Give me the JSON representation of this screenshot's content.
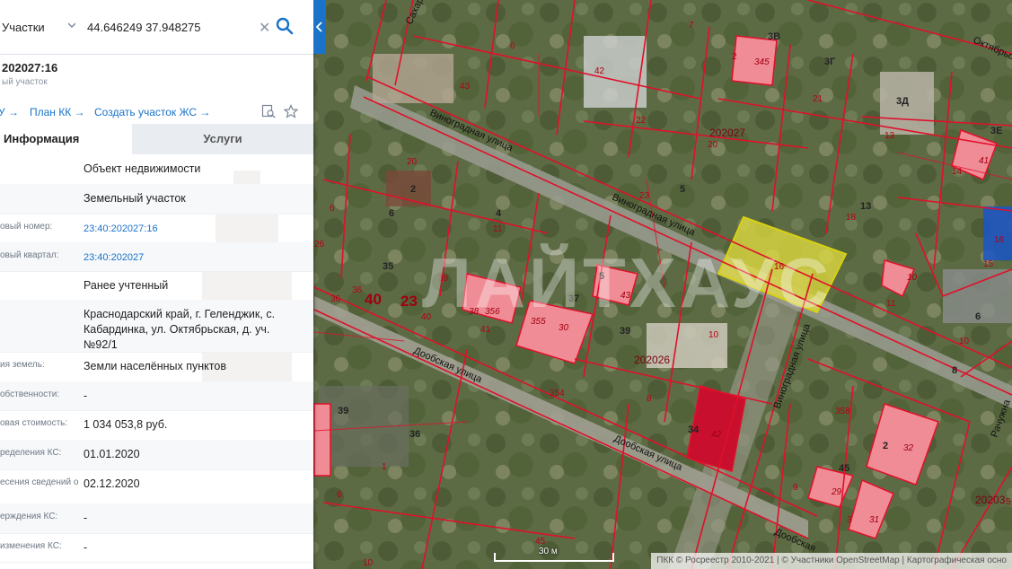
{
  "search": {
    "type": "Участки",
    "query": "44.646249 37.948275"
  },
  "object": {
    "title": "202027:16",
    "subtitle": "ый участок"
  },
  "links": {
    "cut_left": "У →",
    "plan": "План КК →",
    "create": "Создать участок ЖС →"
  },
  "tabs": {
    "info": "Информация",
    "services": "Услуги"
  },
  "rows": [
    {
      "label": "",
      "value": "Объект недвижимости"
    },
    {
      "label": "",
      "value": "Земельный участок"
    },
    {
      "label": "овый номер:",
      "value": "23:40:202027:16",
      "link": true
    },
    {
      "label": "овый квартал:",
      "value": "23:40:202027",
      "link": true
    },
    {
      "label": "",
      "value": "Ранее учтенный"
    },
    {
      "label": "",
      "value": "Краснодарский край, г. Геленджик, с. Кабардинка, ул. Октябрьская, д. уч. №92/1"
    },
    {
      "label": "ия земель:",
      "value": "Земли населённых пунктов"
    },
    {
      "label": "обственности:",
      "value": "-"
    },
    {
      "label": "овая стоимость:",
      "value": "1 034 053,8 руб."
    },
    {
      "label": "ределения КС:",
      "value": "01.01.2020"
    },
    {
      "label": "есения сведений о",
      "value": "02.12.2020"
    },
    {
      "label": "ерждения КС:",
      "value": "-"
    },
    {
      "label": "изменения КС:",
      "value": "-"
    }
  ],
  "map": {
    "streets": [
      "Виноградная улица",
      "Виноградная улица",
      "Дообская улица",
      "Дообская улица",
      "Виноградная улица",
      "Сахарова",
      "Октябрьск",
      "Рачужна"
    ],
    "quarters": [
      "202027",
      "202026",
      "20203"
    ],
    "highlight_plot": "16",
    "big_labels": [
      "40",
      "23"
    ],
    "scale": "30 м",
    "attribution": "ПКК © Росреестр 2010-2021 | © Участники OpenStreetMap | Картографическая осно",
    "watermark": "ЛАЙТХАУС",
    "colors": {
      "boundary": "#e0102a",
      "highlight": "#e6e040",
      "building": "#f08c96",
      "building_dark": "#c8102e",
      "accent": "#1a73c8"
    }
  }
}
